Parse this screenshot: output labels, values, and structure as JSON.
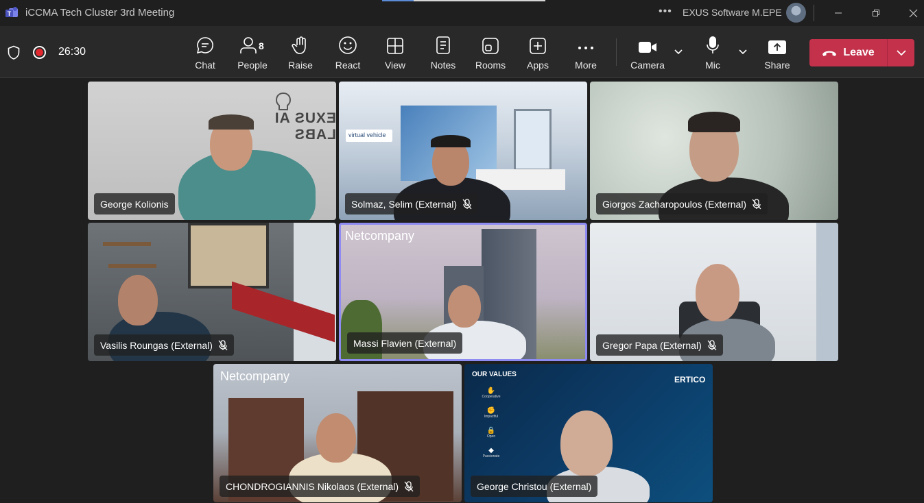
{
  "window": {
    "title": "iCCMA Tech Cluster 3rd Meeting",
    "org": "EXUS Software M.EPE"
  },
  "toolbar": {
    "timer": "26:30",
    "buttons": [
      {
        "id": "chat",
        "label": "Chat",
        "icon": "chat-icon"
      },
      {
        "id": "people",
        "label": "People",
        "icon": "people-icon",
        "count": "8"
      },
      {
        "id": "raise",
        "label": "Raise",
        "icon": "hand-icon"
      },
      {
        "id": "react",
        "label": "React",
        "icon": "smiley-icon"
      },
      {
        "id": "view",
        "label": "View",
        "icon": "grid-icon"
      },
      {
        "id": "notes",
        "label": "Notes",
        "icon": "notes-icon"
      },
      {
        "id": "rooms",
        "label": "Rooms",
        "icon": "rooms-icon"
      },
      {
        "id": "apps",
        "label": "Apps",
        "icon": "plus-icon"
      },
      {
        "id": "more",
        "label": "More",
        "icon": "ellipsis-icon"
      },
      {
        "id": "camera",
        "label": "Camera",
        "icon": "camera-icon"
      },
      {
        "id": "mic",
        "label": "Mic",
        "icon": "mic-icon"
      },
      {
        "id": "share",
        "label": "Share",
        "icon": "share-icon"
      }
    ],
    "leave_label": "Leave"
  },
  "participants": [
    {
      "name": "George Kolionis",
      "muted": false,
      "bg_text": "EXUS AI LABS"
    },
    {
      "name": "Solmaz, Selim (External)",
      "muted": true,
      "bg_text": "virtual vehicle"
    },
    {
      "name": "Giorgos Zacharopoulos (External)",
      "muted": true
    },
    {
      "name": "Vasilis Roungas (External)",
      "muted": true
    },
    {
      "name": "Massi Flavien (External)",
      "muted": false,
      "bg_text": "Netcompany",
      "active": true
    },
    {
      "name": "Gregor Papa (External)",
      "muted": true
    },
    {
      "name": "CHONDROGIANNIS Nikolaos (External)",
      "muted": true,
      "bg_text": "Netcompany"
    },
    {
      "name": "George Christou (External)",
      "muted": false,
      "bg_text": "ERTICO"
    }
  ],
  "ertico_values": {
    "heading": "OUR VALUES",
    "items": [
      "Cooperative",
      "Impactful",
      "Open",
      "Passionate"
    ]
  },
  "colors": {
    "leave": "#c4314b",
    "active_border": "#8e8cf2",
    "record": "#e0282e"
  }
}
